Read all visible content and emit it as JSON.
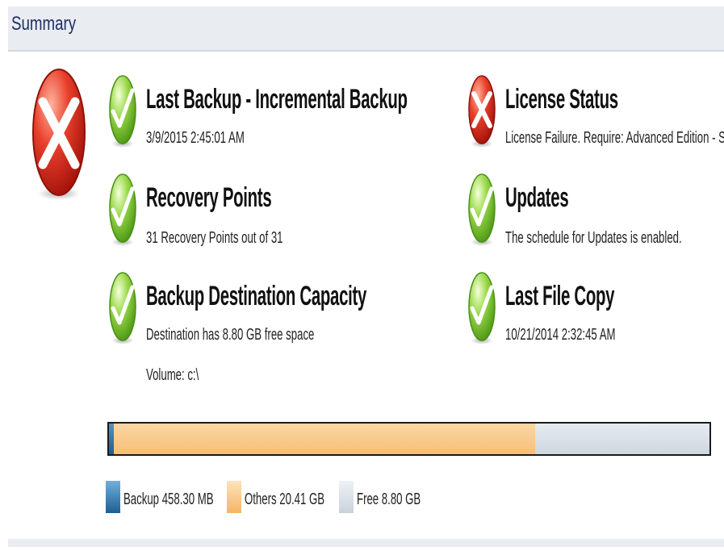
{
  "header": {
    "title": "Summary"
  },
  "overall_status": {
    "icon": "error-x-icon",
    "color": "#d9261c"
  },
  "items": [
    {
      "title": "Last Backup - Incremental Backup",
      "subtitle": "3/9/2015 2:45:01 AM",
      "icon": "check-icon",
      "status": "ok"
    },
    {
      "title": "Recovery Points",
      "subtitle": "31 Recovery Points out of 31",
      "icon": "check-icon",
      "status": "ok"
    },
    {
      "title": "Backup Destination Capacity",
      "subtitle": "Destination has 8.80 GB free space",
      "subtitle2": "Volume: c:\\",
      "icon": "check-icon",
      "status": "ok"
    },
    {
      "title": "License Status",
      "subtitle": "License Failure. Require: Advanced Edition - Socke",
      "icon": "error-x-icon",
      "status": "error"
    },
    {
      "title": "Updates",
      "subtitle": "The schedule for Updates is enabled.",
      "icon": "check-icon",
      "status": "ok"
    },
    {
      "title": "Last File Copy",
      "subtitle": "10/21/2014 2:32:45 AM",
      "icon": "check-icon",
      "status": "ok"
    }
  ],
  "capacity": {
    "segments": [
      {
        "name": "Backup",
        "fraction": 0.0078,
        "color": "#2f78b0"
      },
      {
        "name": "Others",
        "fraction": 0.7024,
        "color": "#f7c585"
      },
      {
        "name": "Free",
        "fraction": 0.2898,
        "color": "#d6dde4"
      }
    ],
    "legend": [
      {
        "label": "Backup 458.30 MB",
        "color": "#2f78b0"
      },
      {
        "label": "Others 20.41 GB",
        "color": "#f7c585"
      },
      {
        "label": "Free 8.80 GB",
        "color": "#d6dde4"
      }
    ]
  },
  "colors": {
    "ok_green": "#7cc22b",
    "error_red": "#d9261c",
    "title_blue": "#1d2f63"
  }
}
